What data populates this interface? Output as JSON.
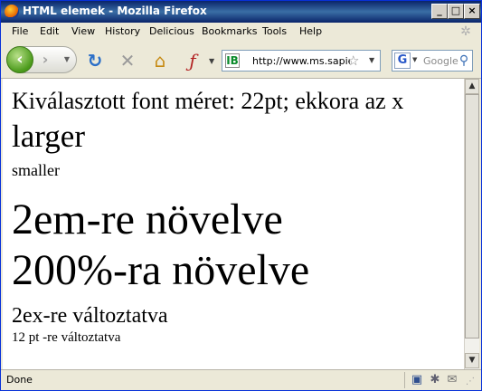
{
  "window": {
    "title": "HTML elemek - Mozilla Firefox",
    "controls": {
      "minimize": "_",
      "maximize": "□",
      "close": "×"
    }
  },
  "menu": {
    "items": [
      "File",
      "Edit",
      "View",
      "History",
      "Delicious",
      "Bookmarks",
      "Tools",
      "Help"
    ]
  },
  "toolbar": {
    "back_icon": "back-arrow-icon",
    "forward_icon": "forward-arrow-icon",
    "reload_icon": "reload-icon",
    "stop_icon": "stop-icon",
    "home_icon": "home-icon",
    "flash_icon": "flash-blocker-icon",
    "url": "http://www.ms.sapientia.ro/~manyi/teaching/html/",
    "site_icon_letter": "IB",
    "search_engine_letter": "G",
    "search_placeholder": "Google"
  },
  "content": {
    "lines": [
      "Kiválasztott font méret: 22pt; ekkora az x",
      "larger",
      "smaller",
      "2em-re növelve",
      "200%-ra növelve",
      "2ex-re változtatva",
      "12 pt -re változtatva"
    ]
  },
  "status": {
    "text": "Done"
  },
  "colors": {
    "titlebar": "#0a246a",
    "chrome": "#ece9d8",
    "page_background": "#ffffff"
  }
}
